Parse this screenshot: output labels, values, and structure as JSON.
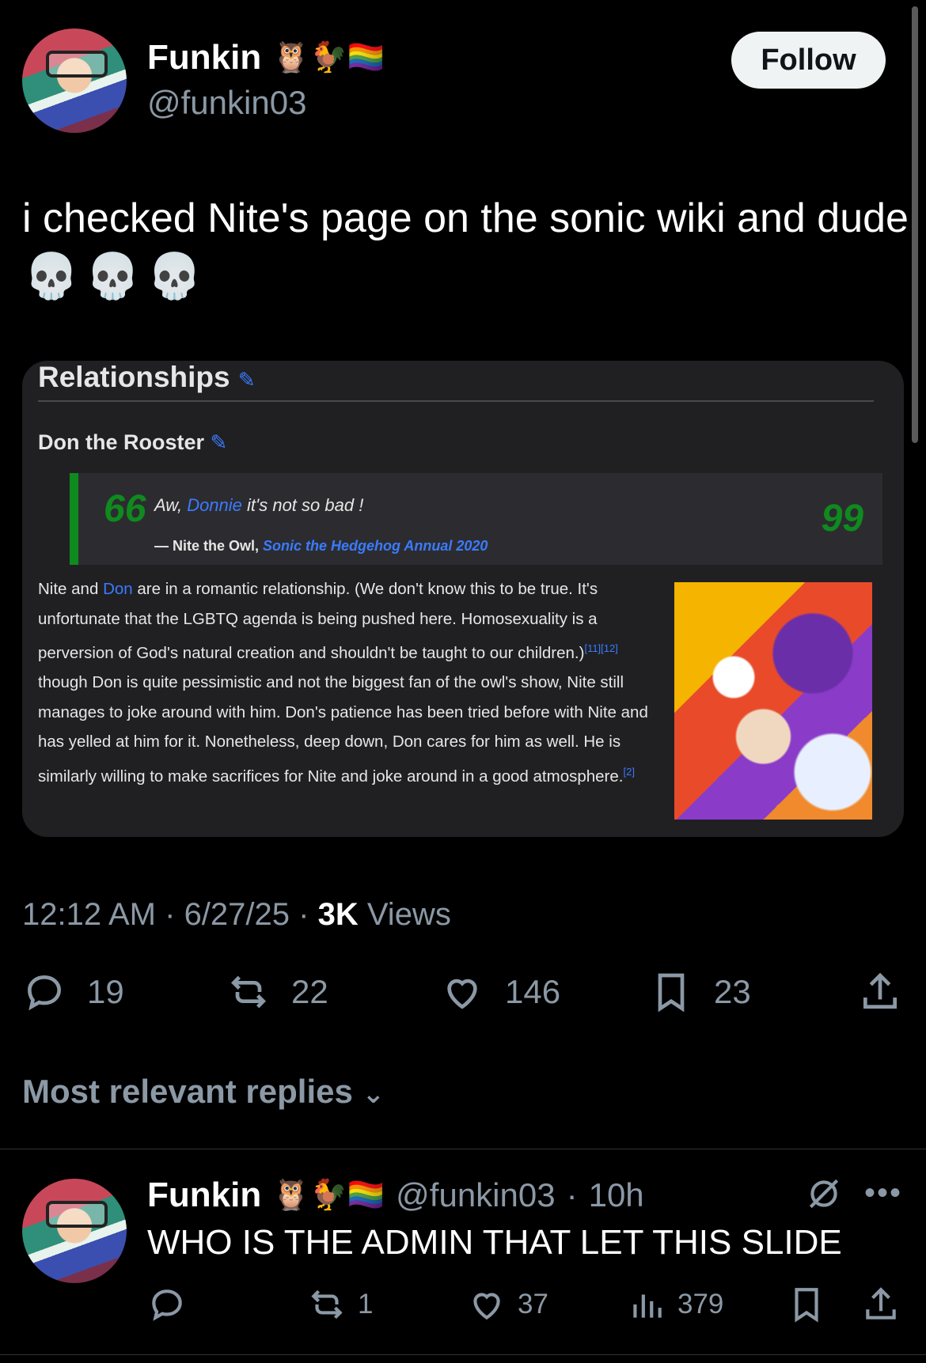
{
  "tweet": {
    "author": {
      "name": "Funkin",
      "emojis": "🦉🐓🏳️‍🌈",
      "handle": "@funkin03"
    },
    "follow_label": "Follow",
    "text": "i checked Nite's page on the sonic wiki and dude",
    "skulls": "💀💀💀",
    "embedded_image": {
      "section_title": "Relationships",
      "subsection_title": "Don the Rooster",
      "quote": {
        "prefix": "Aw, ",
        "link": "Donnie",
        "suffix": " it's not so bad !",
        "cite_prefix": "— Nite the Owl, ",
        "cite_link": "Sonic the Hedgehog Annual 2020",
        "open_mark": "66",
        "close_mark": "99"
      },
      "paragraph": {
        "part1": "Nite and ",
        "link_don": "Don",
        "part2": " are in a romantic relationship. (We don't know this to be true. It's unfortunate that the LGBTQ agenda is being pushed here. Homosexuality is a perversion of God's natural creation and shouldn't be taught to our children.)",
        "ref1": "[11][12]",
        "part3": " though Don is quite pessimistic and not the biggest fan of the owl's show, Nite still manages to joke around with him. Don's patience has been tried before with Nite and has yelled at him for it. Nonetheless, deep down, Don cares for him as well. He is similarly willing to make sacrifices for Nite and joke around in a good atmosphere.",
        "ref2": "[2]"
      }
    },
    "time": "12:12 AM",
    "date": "6/27/25",
    "views_count": "3K",
    "views_label": "Views",
    "actions": {
      "replies": "19",
      "reposts": "22",
      "likes": "146",
      "bookmarks": "23"
    }
  },
  "replies_section": {
    "title": "Most relevant replies"
  },
  "reply": {
    "author_name": "Funkin",
    "emojis": "🦉🐓🏳️‍🌈",
    "handle": "@funkin03",
    "time": "10h",
    "text": "WHO IS THE ADMIN THAT LET THIS SLIDE",
    "actions": {
      "reposts": "1",
      "likes": "37",
      "views": "379"
    }
  }
}
